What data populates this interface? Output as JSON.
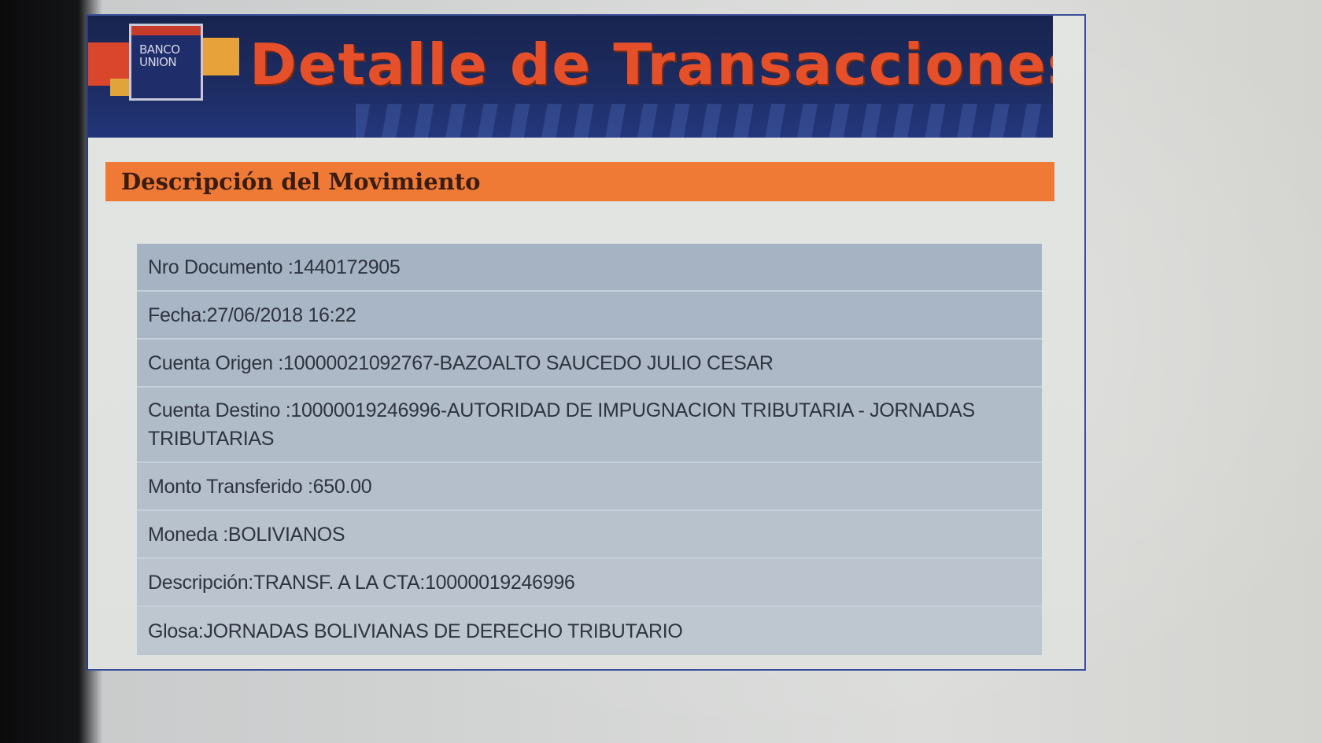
{
  "banner": {
    "title": "Detalle de Transacciones",
    "logo_text": "BANCO UNION"
  },
  "section": {
    "title": "Descripción del Movimiento"
  },
  "details": [
    "Nro Documento :1440172905",
    "Fecha:27/06/2018 16:22",
    "Cuenta Origen :10000021092767-BAZOALTO SAUCEDO JULIO CESAR",
    "Cuenta Destino :10000019246996-AUTORIDAD DE IMPUGNACION TRIBUTARIA - JORNADAS TRIBUTARIAS",
    "Monto Transferido :650.00",
    "Moneda :BOLIVIANOS",
    "Descripción:TRANSF. A LA CTA:10000019246996",
    "Glosa:JORNADAS BOLIVIANAS DE DERECHO TRIBUTARIO"
  ],
  "colors": {
    "banner_bg": "#1d2c62",
    "title_orange": "#e5502a",
    "section_orange": "#ee7a36",
    "row_bg": "#a9b6c5"
  }
}
